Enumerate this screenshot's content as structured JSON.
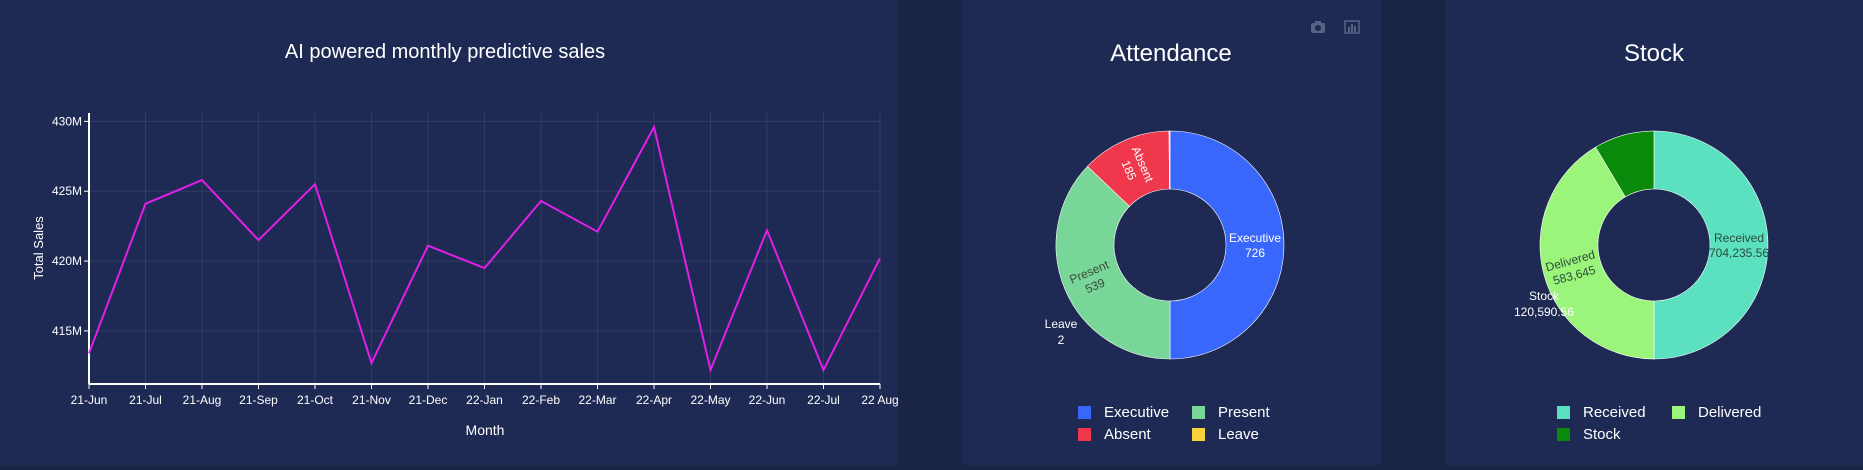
{
  "colors": {
    "line": "#e11fe8",
    "executive": "#3a67fb",
    "present": "#78d698",
    "absent": "#f0384c",
    "leave": "#f7d23a",
    "received": "#5be0c0",
    "delivered": "#9bf57a",
    "stock": "#0a8a0a"
  },
  "modebar": {
    "camera_icon": "camera-icon",
    "chart_icon": "bar-chart-icon"
  },
  "chart_data": [
    {
      "type": "line",
      "title": "AI powered monthly predictive sales",
      "xlabel": "Month",
      "ylabel": "Total Sales",
      "grid": true,
      "categories": [
        "21-Jun",
        "21-Jul",
        "21-Aug",
        "21-Sep",
        "21-Oct",
        "21-Nov",
        "21-Dec",
        "22-Jan",
        "22-Feb",
        "22-Mar",
        "22-Apr",
        "22-May",
        "22-Jun",
        "22-Jul",
        "22 Aug"
      ],
      "values": [
        413.4,
        424.1,
        425.8,
        421.5,
        425.5,
        412.7,
        421.1,
        419.5,
        424.3,
        422.1,
        429.6,
        412.2,
        422.2,
        412.2,
        420.2
      ],
      "ylim": [
        411.2,
        430.6
      ],
      "yticks": [
        415,
        420,
        425,
        430
      ],
      "ytick_labels": [
        "415M",
        "420M",
        "425M",
        "430M"
      ]
    },
    {
      "type": "pie",
      "title": "Attendance",
      "legend_position": "bottom",
      "labels": [
        "Executive",
        "Present",
        "Absent",
        "Leave"
      ],
      "values": [
        726,
        539,
        185,
        2
      ],
      "value_labels": [
        "726",
        "539",
        "185",
        "2"
      ]
    },
    {
      "type": "pie",
      "title": "Stock",
      "legend_position": "bottom",
      "labels": [
        "Received",
        "Delivered",
        "Stock"
      ],
      "values": [
        704235.56,
        583645,
        120590.56
      ],
      "value_labels": [
        "704,235.56",
        "583,645",
        "120,590.56"
      ]
    }
  ]
}
